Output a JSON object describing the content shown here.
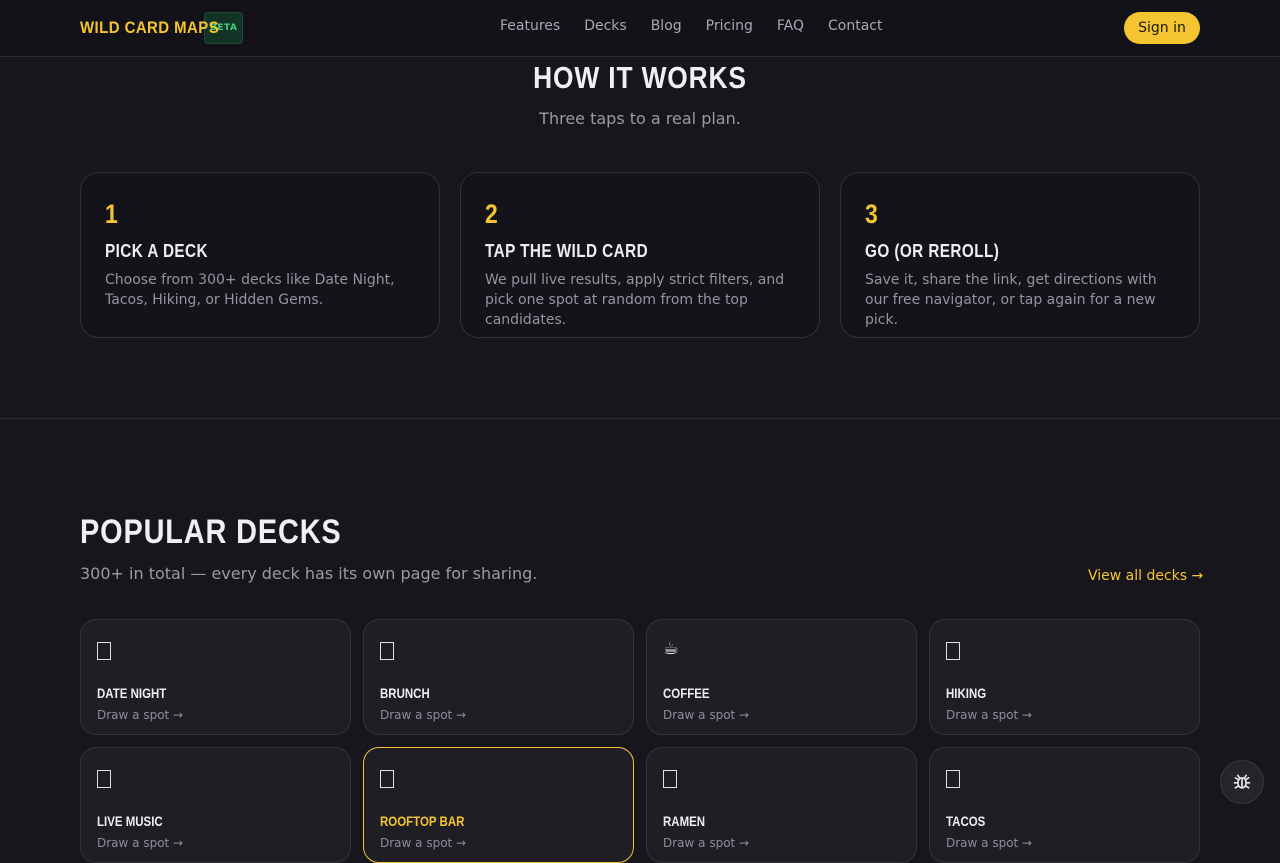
{
  "header": {
    "brand": "WILD CARD MAPS",
    "badge": "BETA",
    "nav": [
      "Features",
      "Decks",
      "Blog",
      "Pricing",
      "FAQ",
      "Contact"
    ],
    "signin": "Sign in"
  },
  "how": {
    "title": "HOW IT WORKS",
    "subtitle": "Three taps to a real plan.",
    "steps": [
      {
        "num": "1",
        "title": "PICK A DECK",
        "desc": "Choose from 300+ decks like Date Night, Tacos, Hiking, or Hidden Gems."
      },
      {
        "num": "2",
        "title": "TAP THE WILD CARD",
        "desc": "We pull live results, apply strict filters, and pick one spot at random from the top candidates."
      },
      {
        "num": "3",
        "title": "GO (OR REROLL)",
        "desc": "Save it, share the link, get directions with our free navigator, or tap again for a new pick."
      }
    ]
  },
  "popular": {
    "title": "POPULAR DECKS",
    "subtitle": "300+ in total — every deck has its own page for sharing.",
    "view_all": "View all decks →",
    "decks": [
      {
        "name": "DATE NIGHT",
        "icon": "missing-glyph-icon",
        "cta": "Draw a spot →"
      },
      {
        "name": "BRUNCH",
        "icon": "missing-glyph-icon",
        "cta": "Draw a spot →"
      },
      {
        "name": "COFFEE",
        "icon": "coffee-icon",
        "glyph": "☕",
        "cta": "Draw a spot →"
      },
      {
        "name": "HIKING",
        "icon": "missing-glyph-icon",
        "cta": "Draw a spot →"
      },
      {
        "name": "LIVE MUSIC",
        "icon": "missing-glyph-icon",
        "cta": "Draw a spot →"
      },
      {
        "name": "ROOFTOP BAR",
        "icon": "missing-glyph-icon",
        "cta": "Draw a spot →",
        "active": true
      },
      {
        "name": "RAMEN",
        "icon": "missing-glyph-icon",
        "cta": "Draw a spot →"
      },
      {
        "name": "TACOS",
        "icon": "missing-glyph-icon",
        "cta": "Draw a spot →"
      }
    ]
  },
  "colors": {
    "accent": "#f5c531",
    "background": "#17161c",
    "badge": "#3fcf78"
  }
}
